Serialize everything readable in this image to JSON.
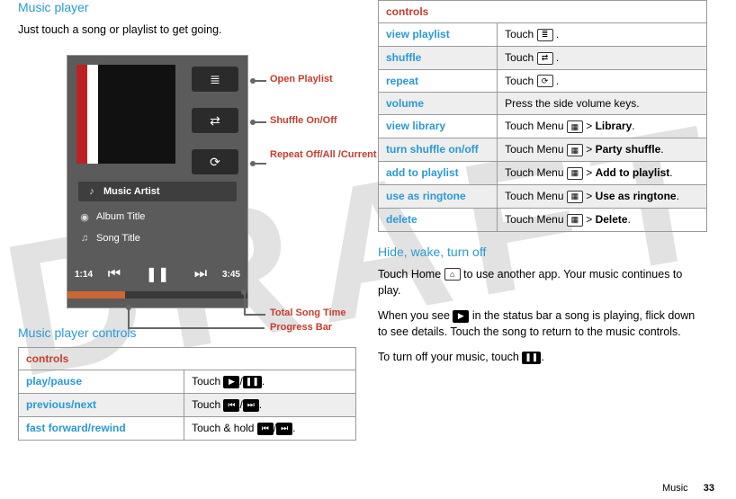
{
  "watermark": "DRAFT",
  "left": {
    "heading_player": "Music player",
    "intro": "Just touch a song or playlist to get going.",
    "heading_controls": "Music player controls",
    "callouts": {
      "playlist": "Open Playlist",
      "shuffle": "Shuffle On/Off",
      "repeat": "Repeat Off/All /Current",
      "total_time": "Total Song Time",
      "progress": "Progress Bar"
    },
    "mock": {
      "artist": "Music Artist",
      "album": "Album Title",
      "song": "Song Title",
      "time_elapsed": "1:14",
      "time_total": "3:45"
    },
    "table_header": "controls",
    "rows": [
      {
        "feature": "play/pause",
        "action_pre": "Touch ",
        "icon1": "▶",
        "sep": "/",
        "icon2": "❚❚",
        "action_post": "."
      },
      {
        "feature": "previous/next",
        "action_pre": "Touch ",
        "icon1": "⏮",
        "sep": "/",
        "icon2": "⏭",
        "action_post": "."
      },
      {
        "feature": "fast forward/rewind",
        "action_pre": "Touch & hold ",
        "icon1": "⏮",
        "sep": "/",
        "icon2": "⏭",
        "action_post": "."
      }
    ]
  },
  "right": {
    "table_header": "controls",
    "rows": [
      {
        "feature": "view playlist",
        "parts": [
          "Touch ",
          {
            "icon": "≣"
          },
          " ."
        ]
      },
      {
        "feature": "shuffle",
        "parts": [
          "Touch ",
          {
            "icon": "⇄"
          },
          " ."
        ]
      },
      {
        "feature": "repeat",
        "parts": [
          "Touch ",
          {
            "icon": "⟳"
          },
          " ."
        ]
      },
      {
        "feature": "volume",
        "parts": [
          "Press the side volume keys."
        ]
      },
      {
        "feature": "view library",
        "parts": [
          "Touch Menu ",
          {
            "icon": "▦"
          },
          " > ",
          {
            "b": "Library"
          },
          "."
        ]
      },
      {
        "feature": "turn shuffle on/off",
        "parts": [
          "Touch Menu ",
          {
            "icon": "▦"
          },
          " > ",
          {
            "b": "Party shuffle"
          },
          "."
        ]
      },
      {
        "feature": "add to playlist",
        "parts": [
          "Touch Menu ",
          {
            "icon": "▦"
          },
          " > ",
          {
            "b": "Add to playlist"
          },
          "."
        ]
      },
      {
        "feature": "use as ringtone",
        "parts": [
          "Touch Menu ",
          {
            "icon": "▦"
          },
          " > ",
          {
            "b": "Use as ringtone"
          },
          "."
        ]
      },
      {
        "feature": "delete",
        "parts": [
          "Touch Menu ",
          {
            "icon": "▦"
          },
          " > ",
          {
            "b": "Delete"
          },
          "."
        ]
      }
    ],
    "heading_hide": "Hide, wake, turn off",
    "para1_pre": "Touch Home ",
    "para1_post": " to use another app. Your music continues to play.",
    "para2_pre": "When you see ",
    "para2_post": " in the status bar a song is playing, flick down to see details. Touch the song to return to the music controls.",
    "para3_pre": "To turn off your music, touch ",
    "para3_post": "."
  },
  "footer": {
    "category": "Music",
    "page": "33"
  }
}
